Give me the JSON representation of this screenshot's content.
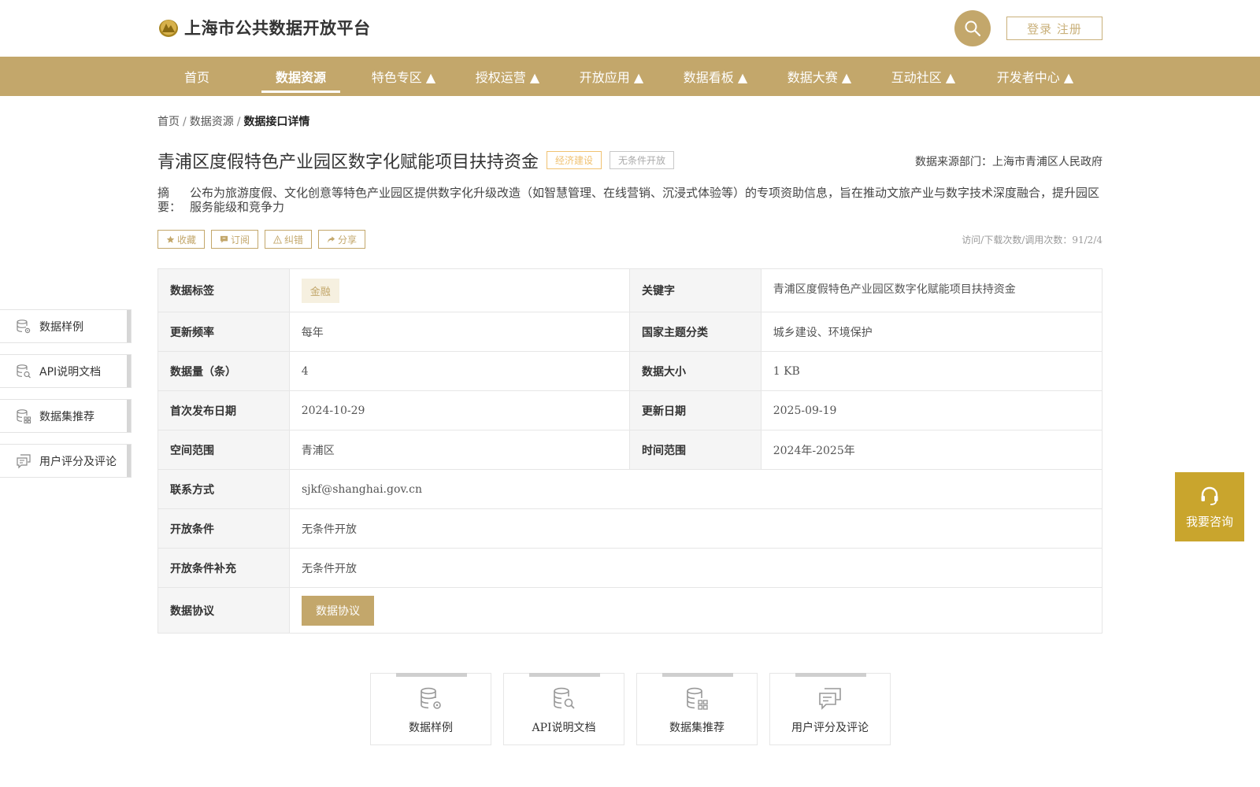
{
  "header": {
    "site_title": "上海市公共数据开放平台",
    "login_label": "登录 注册",
    "icons": {
      "logo": "platform-logo",
      "search": "search-icon"
    }
  },
  "nav": {
    "items": [
      {
        "label": "首页"
      },
      {
        "label": "数据资源"
      },
      {
        "label": "特色专区 ▲"
      },
      {
        "label": "授权运营 ▲"
      },
      {
        "label": "开放应用 ▲"
      },
      {
        "label": "数据看板 ▲"
      },
      {
        "label": "数据大赛 ▲"
      },
      {
        "label": "互动社区 ▲"
      },
      {
        "label": "开发者中心 ▲"
      }
    ],
    "active_index": 1
  },
  "breadcrumb": {
    "items": [
      "首页",
      "数据资源"
    ],
    "separator": "/",
    "current": "数据接口详情"
  },
  "dataset": {
    "title": "青浦区度假特色产业园区数字化赋能项目扶持资金",
    "tags": [
      "经济建设",
      "无条件开放"
    ],
    "source": "数据来源部门：上海市青浦区人民政府",
    "summary_label": "摘 要：",
    "summary": "公布为旅游度假、文化创意等特色产业园区提供数字化升级改造（如智慧管理、在线营销、沉浸式体验等）的专项资助信息，旨在推动文旅产业与数字技术深度融合，提升园区服务能级和竞争力",
    "actions": [
      {
        "label": "收藏",
        "icon": "star-icon"
      },
      {
        "label": "订阅",
        "icon": "subscribe-icon"
      },
      {
        "label": "纠错",
        "icon": "warning-icon"
      },
      {
        "label": "分享",
        "icon": "share-icon"
      }
    ],
    "stats": "访问/下载次数/调用次数：91/2/4"
  },
  "table": {
    "data_tag_label": "数据标签",
    "data_tag_value": "金融",
    "keyword_label": "关键字",
    "keyword_value": "青浦区度假特色产业园区数字化赋能项目扶持资金",
    "freq_label": "更新频率",
    "freq_value": "每年",
    "theme_label": "国家主题分类",
    "theme_value": "城乡建设、环境保护",
    "count_label": "数据量（条）",
    "count_value": "4",
    "size_label": "数据大小",
    "size_value": "1 KB",
    "first_pub_label": "首次发布日期",
    "first_pub_value": "2024-10-29",
    "updated_label": "更新日期",
    "updated_value": "2025-09-19",
    "space_label": "空间范围",
    "space_value": "青浦区",
    "time_label": "时间范围",
    "time_value": "2024年-2025年",
    "contact_label": "联系方式",
    "contact_value": "sjkf@shanghai.gov.cn",
    "condition_label": "开放条件",
    "condition_value": "无条件开放",
    "condition_extra_label": "开放条件补充",
    "condition_extra_value": "无条件开放",
    "protocol_label": "数据协议",
    "protocol_button": "数据协议"
  },
  "sidenav": {
    "items": [
      {
        "label": "数据样例",
        "icon": "database-gear-icon"
      },
      {
        "label": "API说明文档",
        "icon": "database-search-icon"
      },
      {
        "label": "数据集推荐",
        "icon": "database-grid-icon"
      },
      {
        "label": "用户评分及评论",
        "icon": "comment-icon"
      }
    ]
  },
  "consult": {
    "label": "我要咨询",
    "icon": "headset-icon",
    "color": "#c9a52d"
  },
  "cards": {
    "items": [
      {
        "label": "数据样例",
        "icon": "database-gear-icon"
      },
      {
        "label": "API说明文档",
        "icon": "database-search-icon"
      },
      {
        "label": "数据集推荐",
        "icon": "database-grid-icon"
      },
      {
        "label": "用户评分及评论",
        "icon": "comment-icon"
      }
    ]
  },
  "colors": {
    "brand": "#c3a76b",
    "tag_orange": "#f0c272",
    "tag_gray": "#aaaaaa"
  }
}
